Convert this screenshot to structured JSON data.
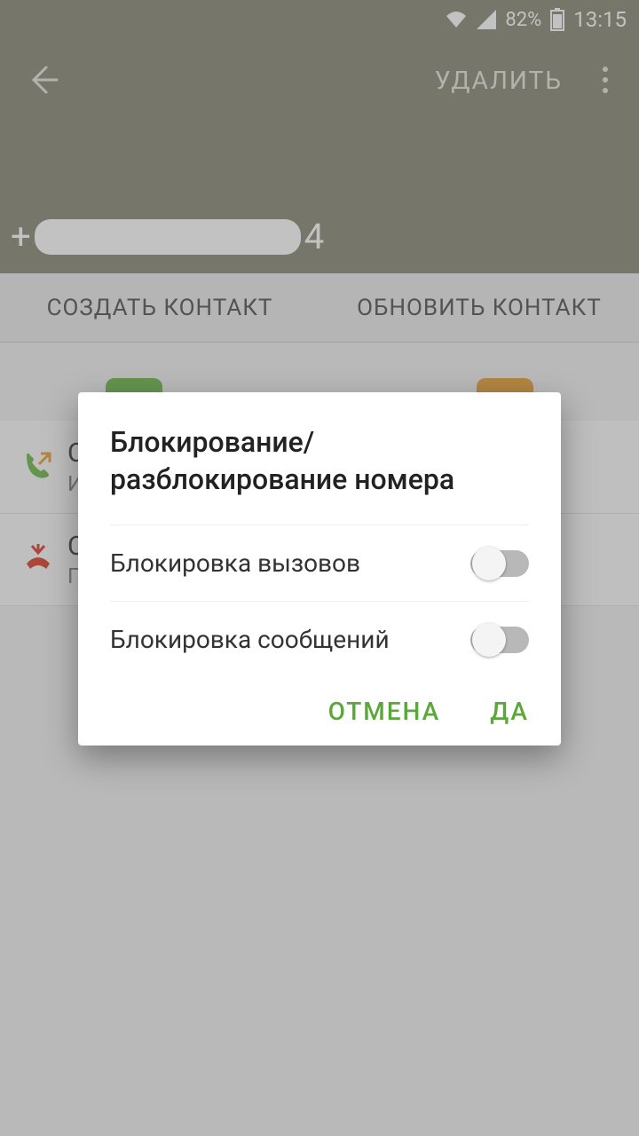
{
  "status": {
    "battery_pct": "82%",
    "time": "13:15"
  },
  "header": {
    "delete_label": "УДАЛИТЬ",
    "phone_prefix": "+",
    "phone_suffix": "4"
  },
  "tabs": {
    "create": "СОЗДАТЬ КОНТАКТ",
    "update": "ОБНОВИТЬ КОНТАКТ"
  },
  "log": {
    "row1_main": "С",
    "row1_sub": "И",
    "row2_main": "С",
    "row2_sub": "П"
  },
  "dialog": {
    "title": "Блокирование/\nразблокирование номера",
    "block_calls_label": "Блокировка вызовов",
    "block_msgs_label": "Блокировка сообщений",
    "block_calls_on": false,
    "block_msgs_on": false,
    "cancel": "ОТМЕНА",
    "ok": "ДА"
  },
  "colors": {
    "accent": "#5aa83a"
  }
}
